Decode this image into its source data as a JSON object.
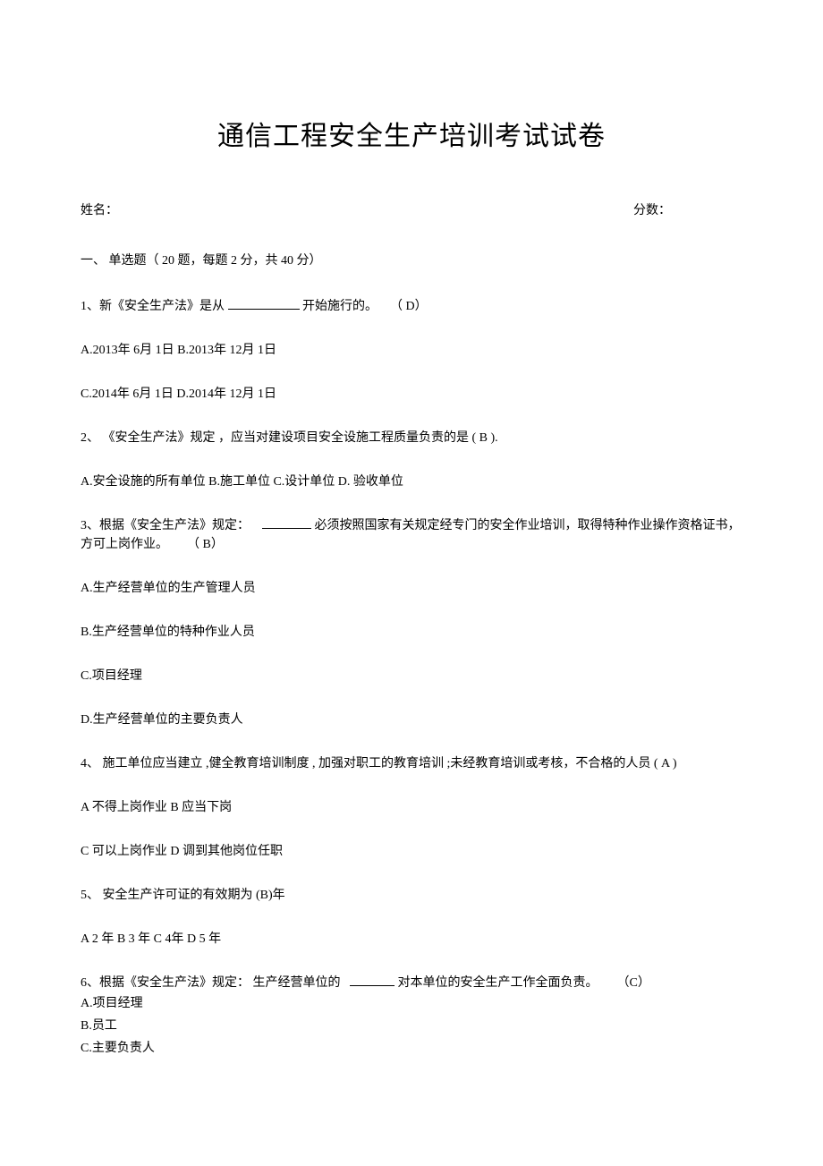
{
  "title": "通信工程安全生产培训考试试卷",
  "header": {
    "name_label": "姓名：",
    "score_label": "分数："
  },
  "section1": {
    "header": "一、  单选题（ 20 题，每题   2 分，共 40  分）"
  },
  "q1": {
    "text_a": "1、新《安全生产法》是从",
    "text_b": "开始施行的。",
    "answer": "（ D）",
    "options_line1": "A.2013年 6月 1日 B.2013年 12月 1日",
    "options_line2": "C.2014年 6月 1日 D.2014年 12月 1日"
  },
  "q2": {
    "text": "2、  《安全生产法》规定   ，应当对建设项目安全设施工程质量负责的是      ( B ).",
    "options": "A.安全设施的所有单位    B.施工单位   C.设计单位   D. 验收单位"
  },
  "q3": {
    "text_a": "3、根据《安全生产法》规定：",
    "text_b": "必须按照国家有关规定经专门的安全作业培训，取得特种作业操作资格证书，方可上岗作业。",
    "answer": "（ B）",
    "opt_a": "A.生产经营单位的生产管理人员",
    "opt_b": "B.生产经营单位的特种作业人员",
    "opt_c": "C.项目经理",
    "opt_d": "D.生产经营单位的主要负责人"
  },
  "q4": {
    "text": "4、  施工单位应当建立 ,健全教育培训制度 , 加强对职工的教育培训 ;未经教育培训或考核，不合格的人员 ( A )",
    "options_line1": "A 不得上岗作业    B 应当下岗",
    "options_line2": "C 可以上岗作业    D 调到其他岗位任职"
  },
  "q5": {
    "text": "5、  安全生产许可证的有效期为      (B)年",
    "options": "A 2 年  B 3 年   C 4年  D 5 年"
  },
  "q6": {
    "text_a": "6、根据《安全生产法》规定：       生产经营单位的",
    "text_b": "对本单位的安全生产工作全面负责。",
    "answer": "（C）",
    "opt_a": "A.项目经理",
    "opt_b": "B.员工",
    "opt_c": "C.主要负责人"
  }
}
